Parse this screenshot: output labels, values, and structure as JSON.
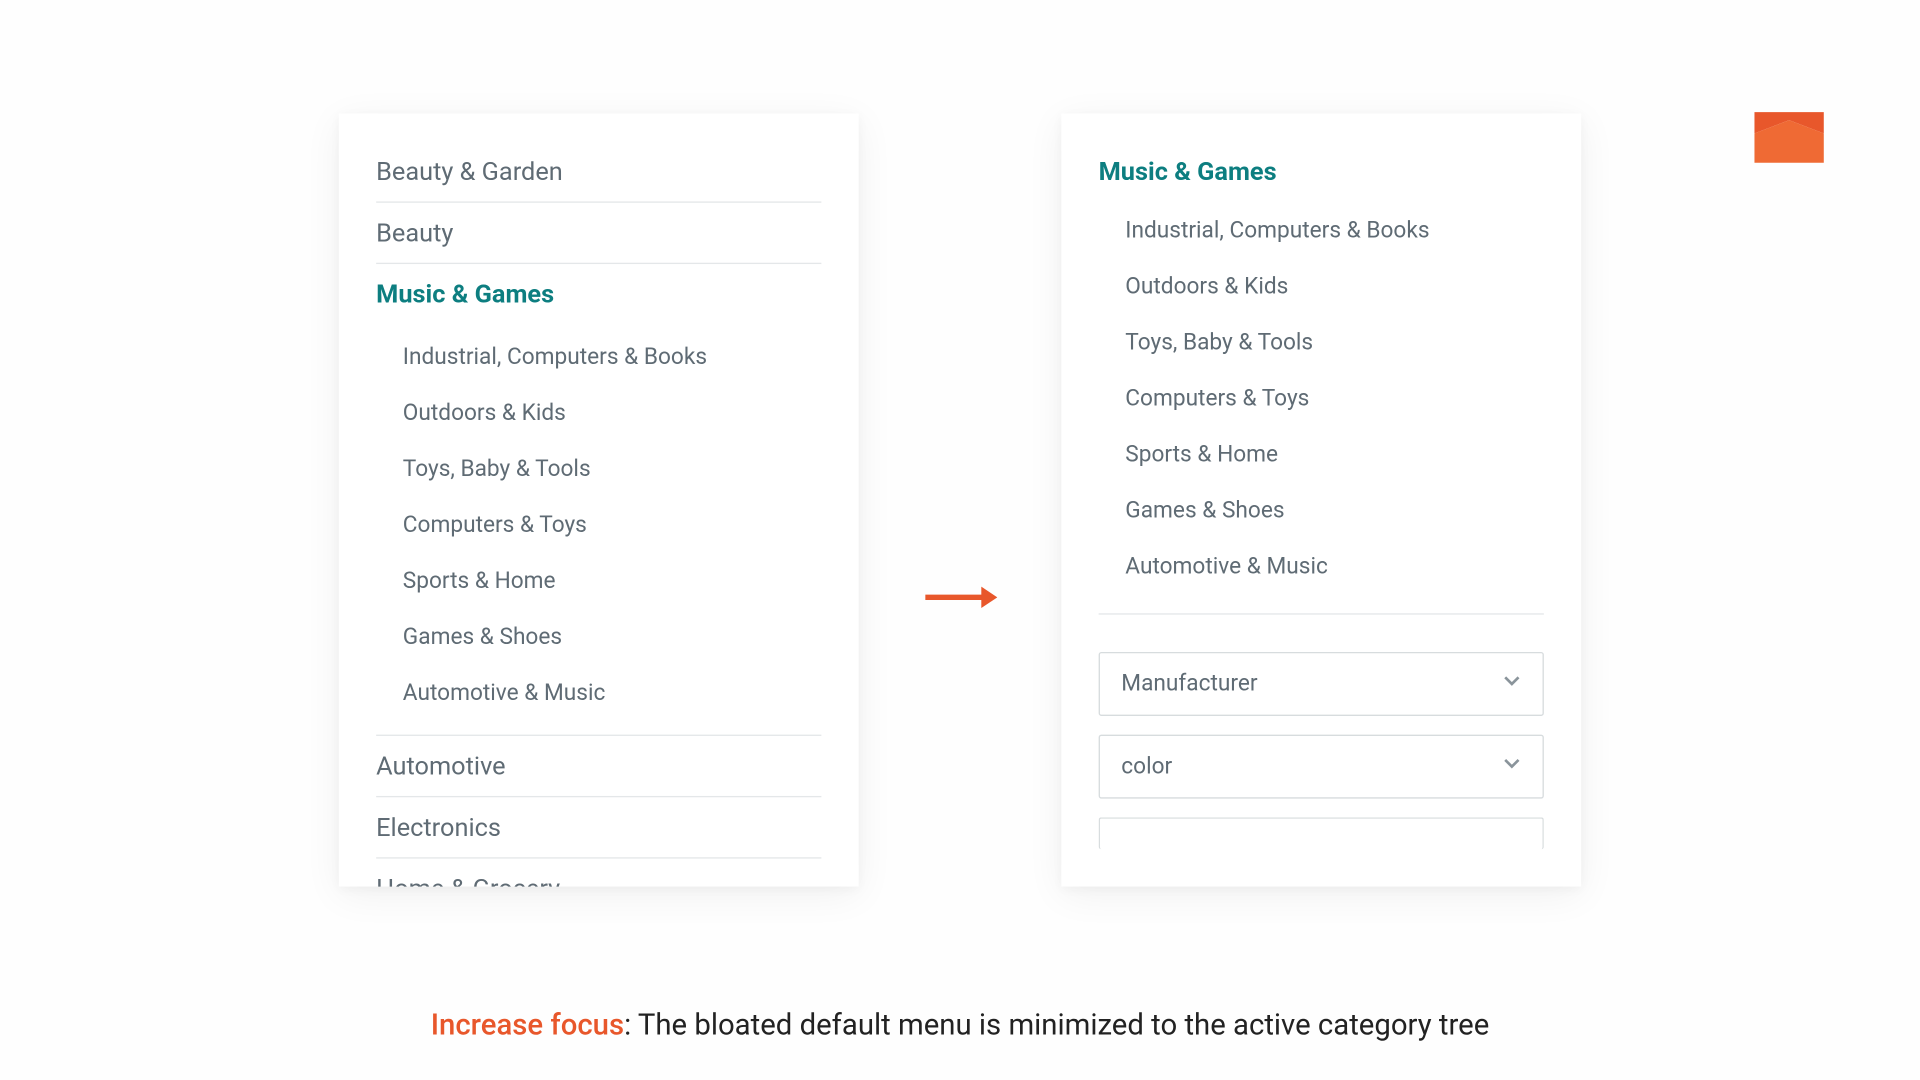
{
  "colors": {
    "accent": "#e8572b",
    "active": "#0d7e80",
    "text": "#5f6b74"
  },
  "left_panel": {
    "top_cats": [
      "Beauty & Garden",
      "Beauty"
    ],
    "active_cat": "Music & Games",
    "sub_cats": [
      "Industrial, Computers & Books",
      "Outdoors & Kids",
      "Toys, Baby & Tools",
      "Computers & Toys",
      "Sports & Home",
      "Games & Shoes",
      "Automotive & Music"
    ],
    "bottom_cats": [
      "Automotive",
      "Electronics",
      "Home & Grocery"
    ]
  },
  "right_panel": {
    "active_cat": "Music & Games",
    "sub_cats": [
      "Industrial, Computers & Books",
      "Outdoors & Kids",
      "Toys, Baby & Tools",
      "Computers & Toys",
      "Sports & Home",
      "Games & Shoes",
      "Automotive & Music"
    ],
    "filters": [
      "Manufacturer",
      "color"
    ]
  },
  "caption": {
    "lead": "Increase focus",
    "rest": ": The bloated default menu is minimized to the active category tree"
  }
}
